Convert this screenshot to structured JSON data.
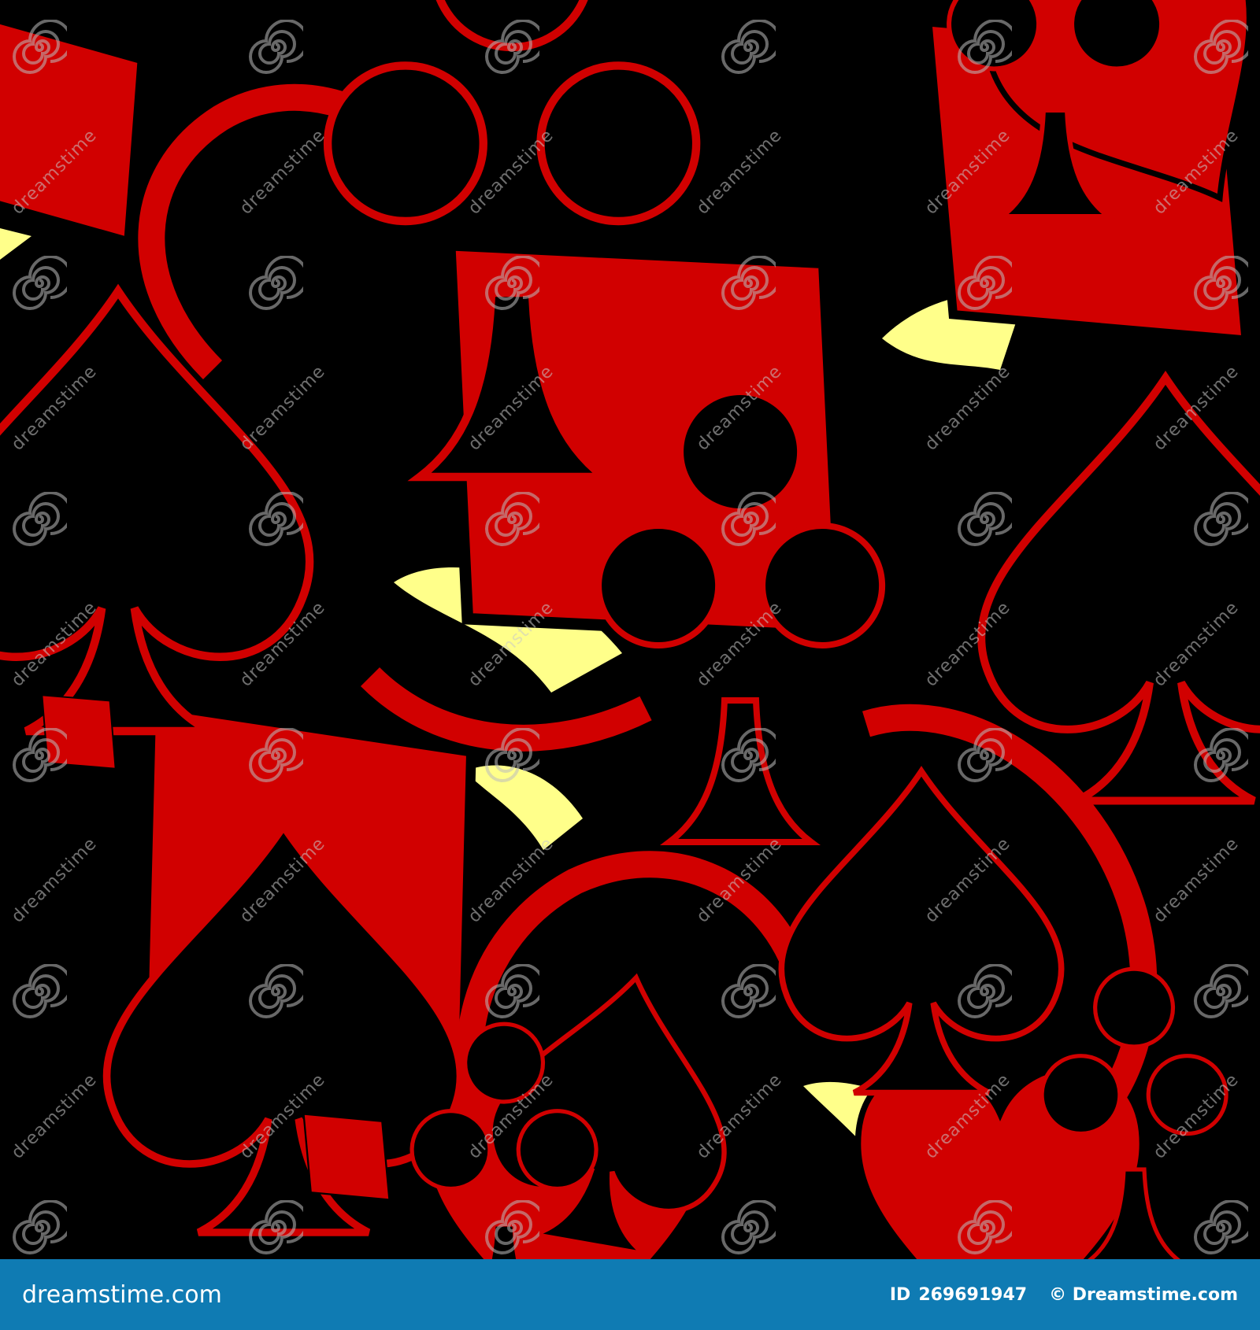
{
  "image": {
    "subject": "seamless pattern of playing card suit symbols",
    "colors": {
      "background": "#000000",
      "primary": "#d10000",
      "black": "#000000",
      "highlight": "#ffff8a",
      "footer": "#0f7bb3"
    },
    "icons": [
      "spade-icon",
      "club-icon",
      "diamond-icon",
      "heart-icon"
    ]
  },
  "watermark": {
    "text": "dreamstime"
  },
  "footer": {
    "brand_text": "dreamstime.com",
    "id_label": "ID",
    "id_value": "269691947",
    "copyright": "© Dreamstime.com"
  }
}
